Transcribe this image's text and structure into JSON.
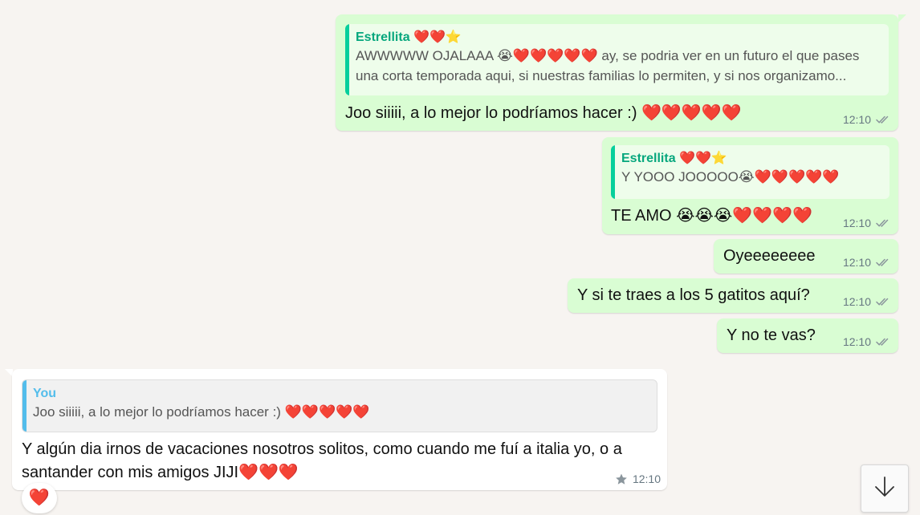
{
  "messages": [
    {
      "direction": "outgoing",
      "quote": {
        "author": "Estrellita ❤️❤️⭐",
        "text": "AWWWWW OJALAAA 😭❤️❤️❤️❤️❤️ ay, se podria ver en un futuro el que pases una corta temporada aqui, si nuestras familias lo permiten, y si nos organizamo..."
      },
      "text": "Joo siiiii, a lo mejor lo podríamos hacer :) ❤️❤️❤️❤️❤️",
      "time": "12:10",
      "status_icon": "double-check-icon"
    },
    {
      "direction": "outgoing",
      "quote": {
        "author": "Estrellita ❤️❤️⭐",
        "text": "Y YOOO JOOOOO😭❤️❤️❤️❤️❤️"
      },
      "text": "TE AMO 😭😭😭❤️❤️❤️❤️",
      "time": "12:10",
      "status_icon": "double-check-icon"
    },
    {
      "direction": "outgoing",
      "text": "Oyeeeeeeee",
      "time": "12:10",
      "status_icon": "double-check-icon"
    },
    {
      "direction": "outgoing",
      "text": "Y si te traes a los 5 gatitos aquí?",
      "time": "12:10",
      "status_icon": "double-check-icon"
    },
    {
      "direction": "outgoing",
      "text": "Y no te vas?",
      "time": "12:10",
      "status_icon": "double-check-icon"
    },
    {
      "direction": "incoming",
      "quote": {
        "author": "You",
        "text": "Joo siiiii, a lo mejor lo podríamos hacer :) ❤️❤️❤️❤️❤️"
      },
      "text": "Y algún dia irnos de vacaciones nosotros solitos, como cuando me fuí a italia yo, o a santander con mis amigos JIJI❤️❤️❤️",
      "time": "12:10",
      "starred": true,
      "status_icon": "star-icon",
      "reaction": "❤️"
    }
  ],
  "scroll_button": {
    "icon": "arrow-down-icon"
  },
  "colors": {
    "chat_background": "#f7f4f1",
    "outgoing_bubble": "#d9fdd3",
    "incoming_bubble": "#ffffff",
    "quote_bar_green": "#06cf9c",
    "quote_bar_blue": "#53bdeb",
    "meta_text": "#667781"
  }
}
